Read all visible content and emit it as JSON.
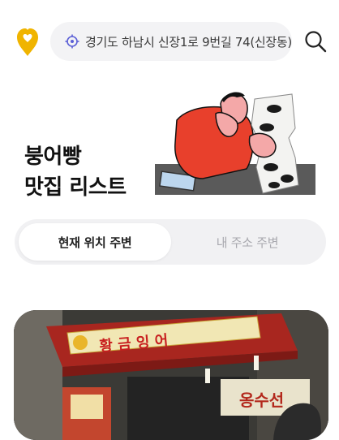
{
  "header": {
    "address": "경기도 하남시 신장1로 9번길 74(신장동)",
    "logo_icon": "pin-heart-icon",
    "location_icon": "crosshair-icon",
    "search_icon": "search-icon",
    "brand_color": "#f0b400"
  },
  "hero": {
    "title_line1": "붕어빵",
    "title_line2": "맛집 리스트",
    "illustration": "man-reading-fish-bread-list-illustration"
  },
  "tabs": [
    {
      "label": "현재 위치 주변",
      "active": true
    },
    {
      "label": "내 주소 주변",
      "active": false
    }
  ],
  "card": {
    "sign_text": "황 금 잉 어",
    "side_sign_text": "옹수선",
    "image": "street-stall-photo"
  }
}
